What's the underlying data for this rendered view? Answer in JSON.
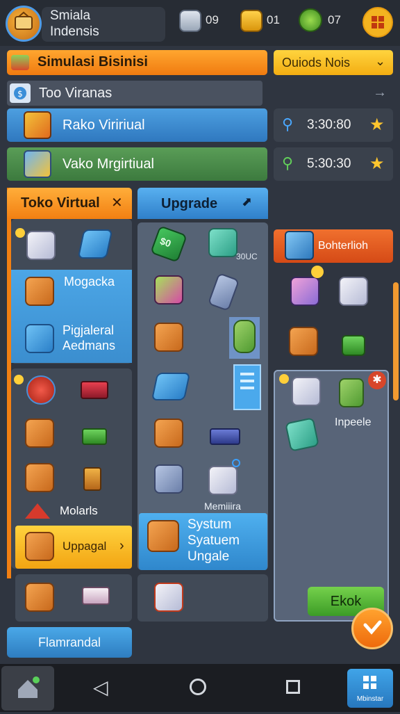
{
  "header": {
    "title_line1": "Smiala",
    "title_line2": "Indensis",
    "resources": [
      {
        "icon": "coin-stack-icon",
        "value": "09"
      },
      {
        "icon": "gold-pile-icon",
        "value": "01"
      },
      {
        "icon": "green-gem-icon",
        "value": "07"
      }
    ]
  },
  "banners": {
    "main": "Simulasi Bisinisi",
    "dropdown": "Ouiods Nois",
    "subheader": "Too Viranas",
    "row1": {
      "label": "Rako Viririual",
      "price": "3:30:80"
    },
    "row2": {
      "label": "Vako Mrgirtiual",
      "price": "5:30:30"
    }
  },
  "panels": {
    "left_tab": "Toko Virtual",
    "middle_tab": "Upgrade",
    "right_tab": "Bohterlioh",
    "left_items": {
      "item1": "Mogacka",
      "item2a": "Pigjaleral",
      "item2b": "Aedmans",
      "item3": "Molarls",
      "item4": "Uppagal"
    },
    "middle_items": {
      "label_small": "30UC",
      "caption": "Memiiira",
      "system_line1": "Systum",
      "system_line2": "Syatuem",
      "system_line3": "Ungale"
    },
    "right_items": {
      "label": "Inpeele",
      "button": "Ekok"
    }
  },
  "bottom_button": "Flamrandal",
  "nav": {
    "right_label": "Mbinstar"
  },
  "colors": {
    "accent": "#f27f12",
    "blue": "#2f7fc9",
    "green": "#3c9c26",
    "bg": "#2f3540"
  }
}
